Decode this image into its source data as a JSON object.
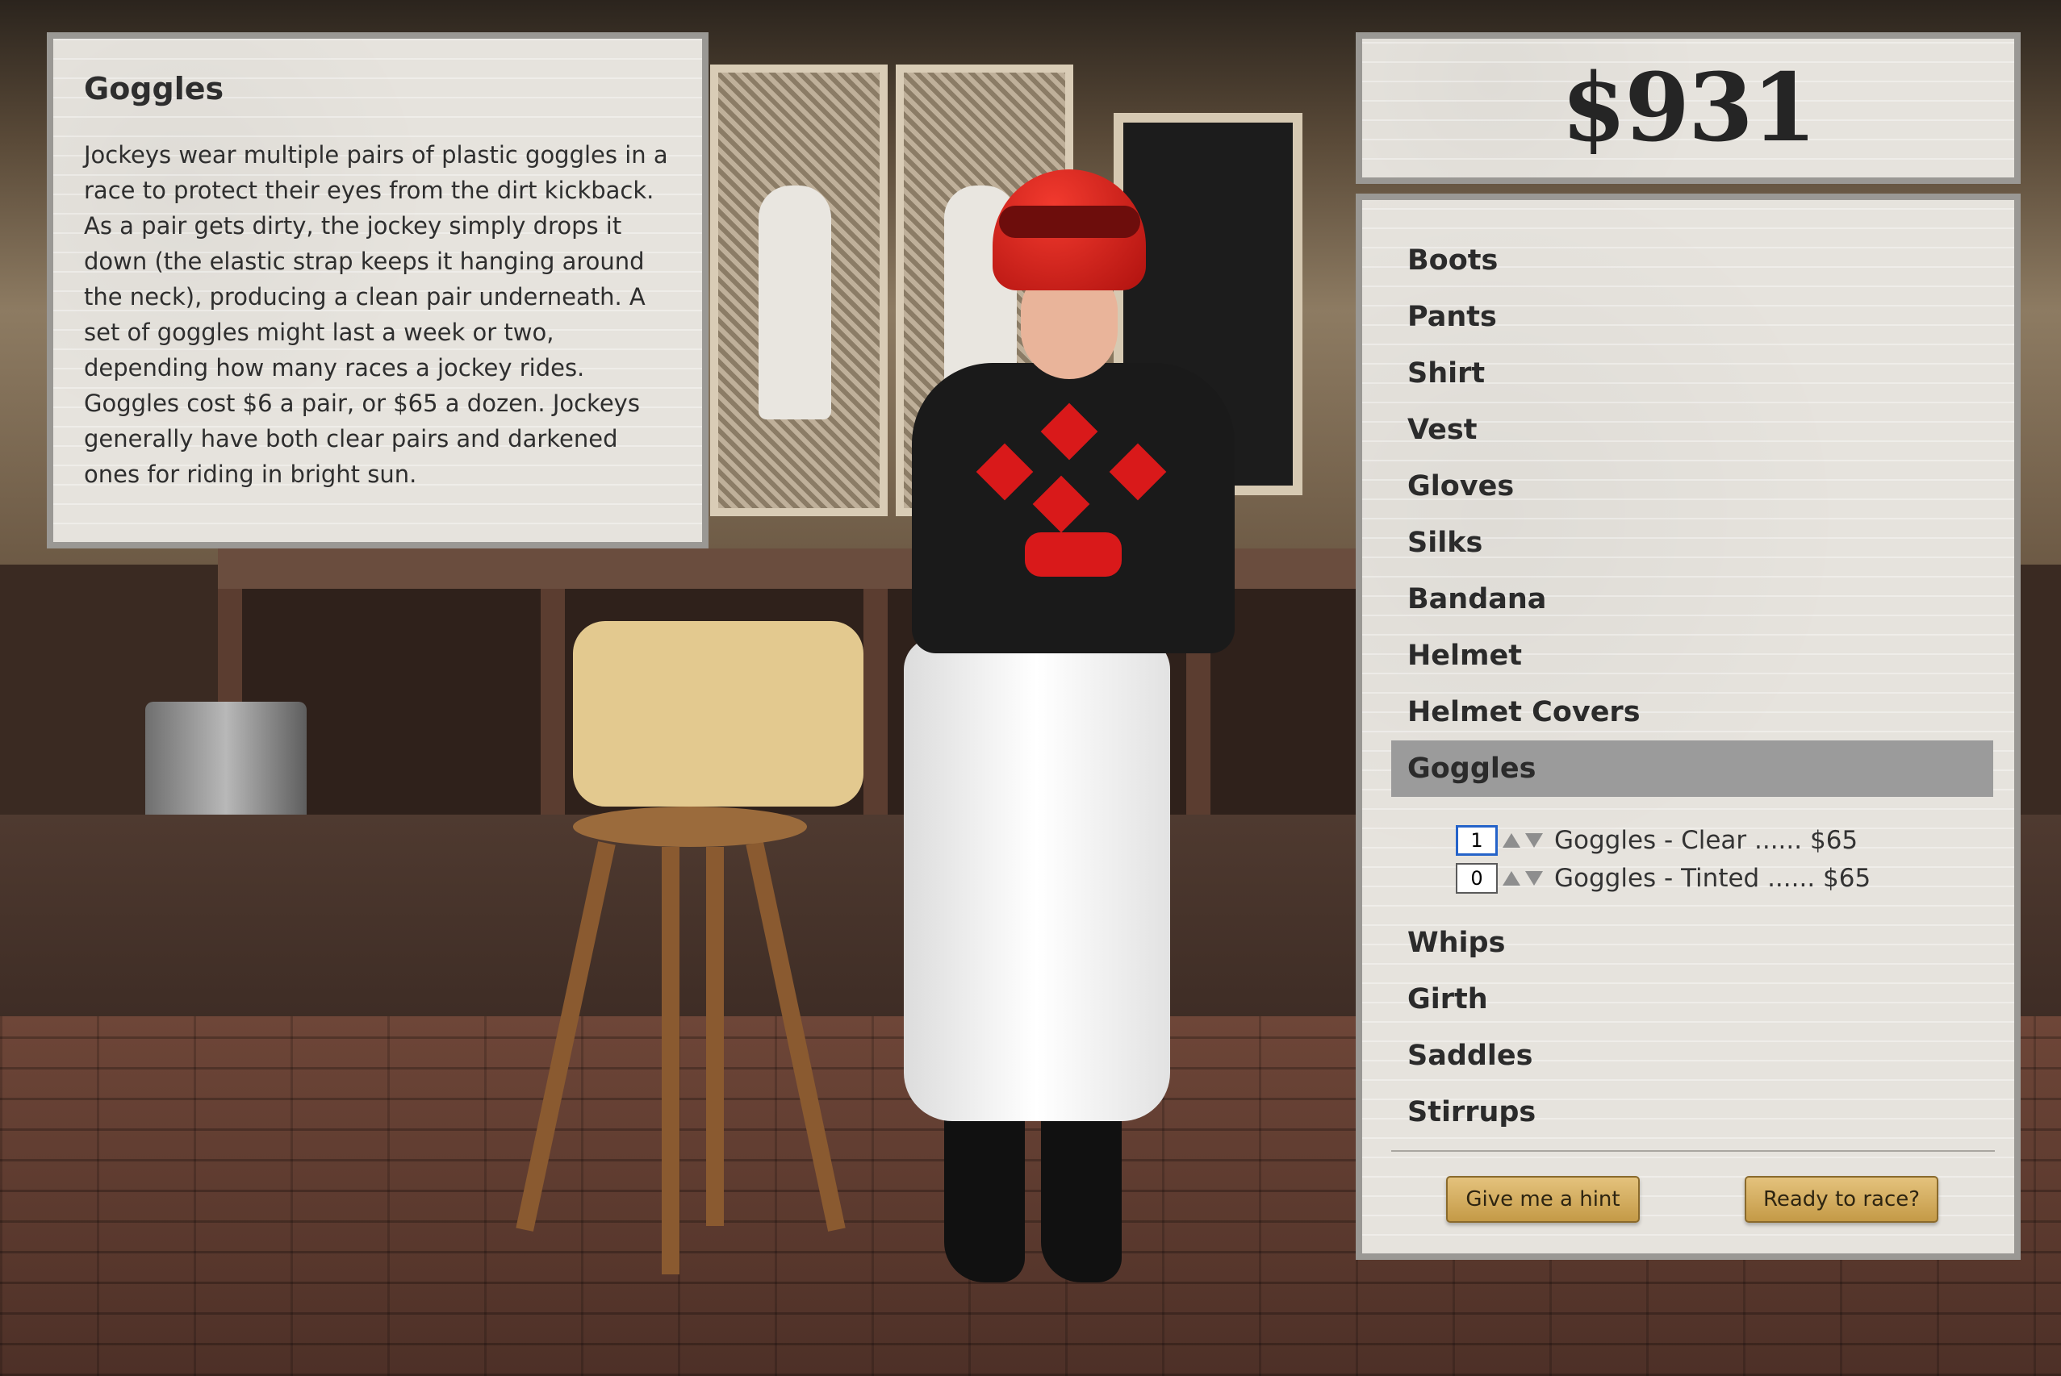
{
  "info": {
    "title": "Goggles",
    "body": "Jockeys wear multiple pairs of plastic goggles in a race to protect their eyes from the dirt kickback. As a pair gets dirty, the jockey simply drops it down (the elastic strap keeps it hanging around the neck), producing a clean pair underneath. A set of goggles might last a week or two, depending how many races a jockey rides. Goggles cost $6 a pair, or $65 a dozen. Jockeys generally have both clear pairs and darkened ones for riding in bright sun."
  },
  "budget": {
    "amount": "$931"
  },
  "menu": {
    "items_before": [
      "Boots",
      "Pants",
      "Shirt",
      "Vest",
      "Gloves",
      "Silks",
      "Bandana",
      "Helmet",
      "Helmet Covers"
    ],
    "active": "Goggles",
    "options": [
      {
        "qty": "1",
        "label": "Goggles - Clear ...... $65"
      },
      {
        "qty": "0",
        "label": "Goggles - Tinted ...... $65"
      }
    ],
    "items_after": [
      "Whips",
      "Girth",
      "Saddles",
      "Stirrups"
    ]
  },
  "buttons": {
    "hint": "Give me a hint",
    "race": "Ready to race?"
  },
  "icons": {
    "increment": "triangle-up-icon",
    "decrement": "triangle-down-icon"
  },
  "colors": {
    "active_row": "#9b9b9b",
    "button_gold": "#d3ae5f",
    "panel_bg": "#e6e3dd"
  }
}
